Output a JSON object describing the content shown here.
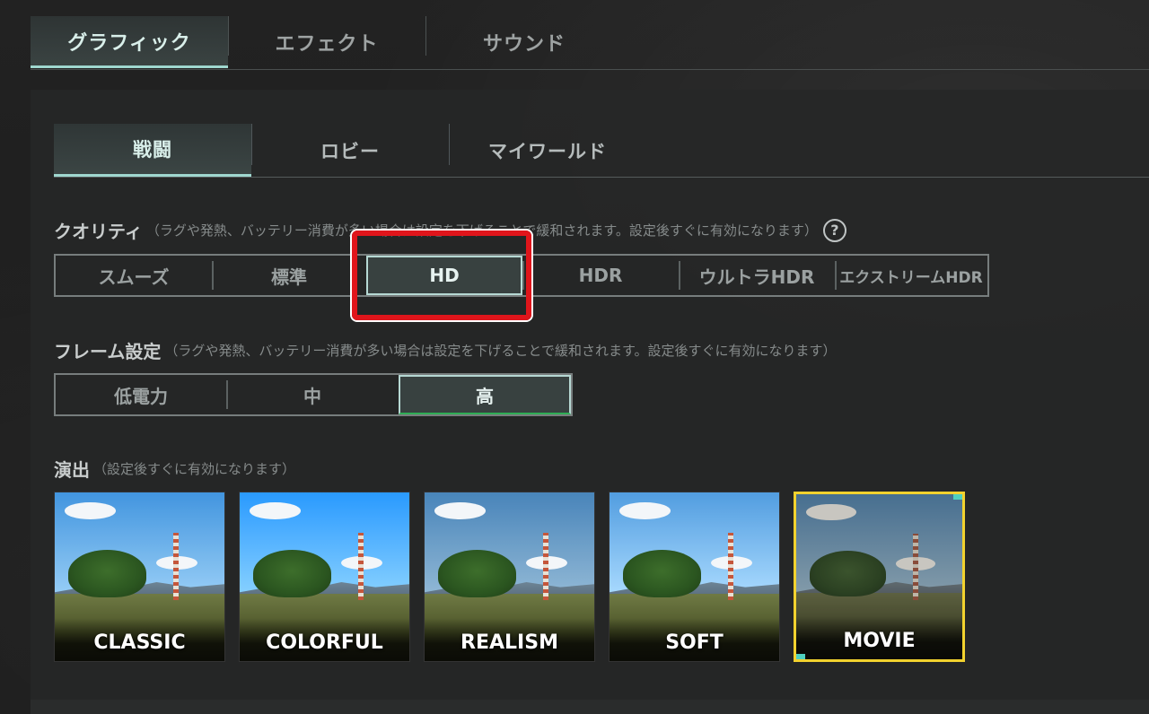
{
  "top_tabs": [
    "グラフィック",
    "エフェクト",
    "サウンド"
  ],
  "top_tab_active": 0,
  "sub_tabs": [
    "戦闘",
    "ロビー",
    "マイワールド"
  ],
  "sub_tab_active": 0,
  "quality": {
    "label": "クオリティ",
    "note": "（ラグや発熱、バッテリー消費が多い場合は設定を下げることで緩和されます。設定後すぐに有効になります）",
    "help": "?",
    "options": [
      "スムーズ",
      "標準",
      "HD",
      "HDR",
      "ウルトラHDR",
      "エクストリームHDR"
    ],
    "selected": "HD"
  },
  "frame": {
    "label": "フレーム設定",
    "note": "（ラグや発熱、バッテリー消費が多い場合は設定を下げることで緩和されます。設定後すぐに有効になります）",
    "options": [
      "低電力",
      "中",
      "高"
    ],
    "selected": "高"
  },
  "style": {
    "label": "演出",
    "note": "（設定後すぐに有効になります）",
    "options": [
      "CLASSIC",
      "COLORFUL",
      "REALISM",
      "SOFT",
      "MOVIE"
    ],
    "selected": "MOVIE"
  },
  "colors": {
    "accent": "#9fd7cf",
    "highlight_red": "#e0151b",
    "selected_yellow": "#f2d22e",
    "selected_green": "#2fae55"
  }
}
